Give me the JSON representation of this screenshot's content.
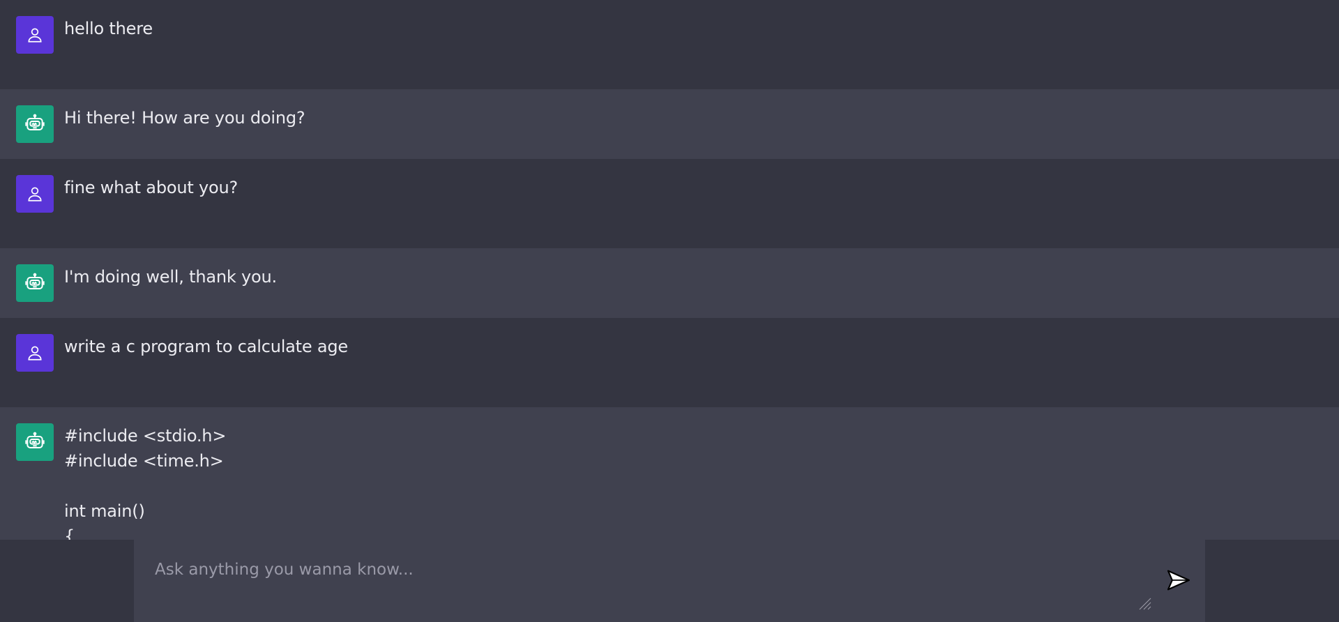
{
  "messages": [
    {
      "role": "user",
      "text": "hello there"
    },
    {
      "role": "bot",
      "text": "Hi there! How are you doing?"
    },
    {
      "role": "user",
      "text": "fine what about you?"
    },
    {
      "role": "bot",
      "text": "I'm doing well, thank you."
    },
    {
      "role": "user",
      "text": "write a c program to calculate age"
    },
    {
      "role": "bot",
      "text": "#include <stdio.h>\n#include <time.h>\n\nint main()\n{"
    }
  ],
  "composer": {
    "placeholder": "Ask anything you wanna know...",
    "value": ""
  },
  "icons": {
    "user_avatar": "user-icon",
    "bot_avatar": "robot-icon",
    "send": "send-icon",
    "resize": "resize-grip-icon"
  },
  "colors": {
    "user_avatar": "#5a35d8",
    "bot_avatar": "#19a17f",
    "user_row": "#343541",
    "bot_row": "#40414f"
  }
}
